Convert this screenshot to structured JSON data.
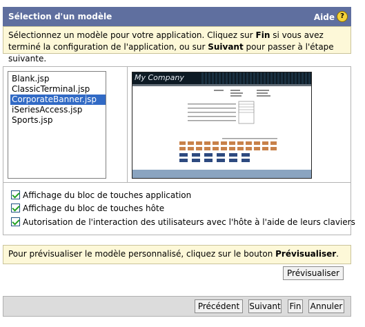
{
  "header": {
    "title": "Sélection d'un modèle",
    "help_label": "Aide",
    "help_icon": "?"
  },
  "instructions": {
    "part1": "Sélectionnez un modèle pour votre application. Cliquez sur ",
    "fin_word": "Fin",
    "part2": " si vous avez terminé la configuration de l'application, ou sur ",
    "suivant_word": "Suivant",
    "part3": " pour passer à l'étape suivante."
  },
  "templates": {
    "items": [
      "Blank.jsp",
      "ClassicTerminal.jsp",
      "CorporateBanner.jsp",
      "iSeriesAccess.jsp",
      "Sports.jsp"
    ],
    "selected": "CorporateBanner.jsp"
  },
  "preview_image": {
    "company_name": "My Company"
  },
  "options": [
    {
      "label": "Affichage du bloc de touches application",
      "checked": true
    },
    {
      "label": "Affichage du bloc de touches hôte",
      "checked": true
    },
    {
      "label": "Autorisation de l'interaction des utilisateurs avec l'hôte à l'aide de leurs claviers",
      "checked": true
    }
  ],
  "preview_prompt": {
    "part1": "Pour prévisualiser le modèle personnalisé, cliquez sur le bouton ",
    "bold": "Prévisualiser",
    "part2": "."
  },
  "buttons": {
    "preview": "Prévisualiser",
    "previous": "Précédent",
    "next": "Suivant",
    "finish": "Fin",
    "cancel": "Annuler"
  },
  "colors": {
    "header_bg": "#5f6f9f",
    "instruction_bg": "#fdf8d8",
    "selection_bg": "#316ac5"
  }
}
